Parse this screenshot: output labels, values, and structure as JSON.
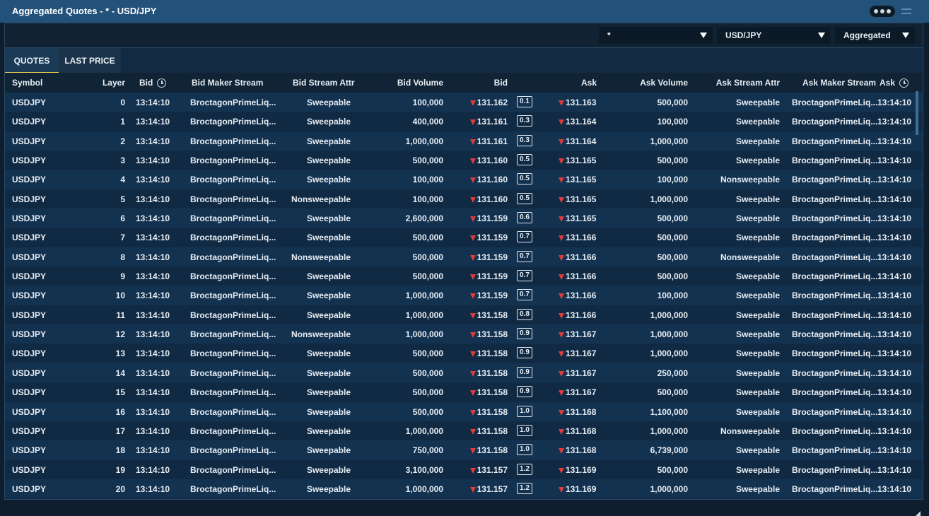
{
  "window": {
    "title": "Aggregated Quotes - * - USD/JPY",
    "more_icon": "ellipsis-icon",
    "menu_icon": "hamburger-icon"
  },
  "filters": {
    "stream": "*",
    "symbol": "USD/JPY",
    "mode": "Aggregated"
  },
  "tabs": [
    {
      "label": "QUOTES",
      "active": true
    },
    {
      "label": "LAST PRICE",
      "active": false
    }
  ],
  "columns": {
    "symbol": "Symbol",
    "layer": "Layer",
    "bid_time": "Bid",
    "bid_maker_stream": "Bid Maker Stream",
    "bid_stream_attr": "Bid Stream Attr",
    "bid_volume": "Bid Volume",
    "bid": "Bid",
    "ask": "Ask",
    "ask_volume": "Ask Volume",
    "ask_stream_attr": "Ask Stream Attr",
    "ask_maker_stream": "Ask Maker Stream",
    "ask_time": "Ask"
  },
  "colors": {
    "titlebar": "#22527a",
    "down_arrow": "#e03a3a",
    "active_tab_underline": "#e6c84e"
  },
  "rows": [
    [
      "USDJPY",
      "0",
      "13:14:10",
      "BroctagonPrimeLiq...",
      "Sweepable",
      "100,000",
      "131.162",
      "0.1",
      "131.163",
      "500,000",
      "Sweepable",
      "BroctagonPrimeLiq...",
      "13:14:10"
    ],
    [
      "USDJPY",
      "1",
      "13:14:10",
      "BroctagonPrimeLiq...",
      "Sweepable",
      "400,000",
      "131.161",
      "0.3",
      "131.164",
      "100,000",
      "Sweepable",
      "BroctagonPrimeLiq...",
      "13:14:10"
    ],
    [
      "USDJPY",
      "2",
      "13:14:10",
      "BroctagonPrimeLiq...",
      "Sweepable",
      "1,000,000",
      "131.161",
      "0.3",
      "131.164",
      "1,000,000",
      "Sweepable",
      "BroctagonPrimeLiq...",
      "13:14:10"
    ],
    [
      "USDJPY",
      "3",
      "13:14:10",
      "BroctagonPrimeLiq...",
      "Sweepable",
      "500,000",
      "131.160",
      "0.5",
      "131.165",
      "500,000",
      "Sweepable",
      "BroctagonPrimeLiq...",
      "13:14:10"
    ],
    [
      "USDJPY",
      "4",
      "13:14:10",
      "BroctagonPrimeLiq...",
      "Sweepable",
      "100,000",
      "131.160",
      "0.5",
      "131.165",
      "100,000",
      "Nonsweepable",
      "BroctagonPrimeLiq...",
      "13:14:10"
    ],
    [
      "USDJPY",
      "5",
      "13:14:10",
      "BroctagonPrimeLiq...",
      "Nonsweepable",
      "100,000",
      "131.160",
      "0.5",
      "131.165",
      "1,000,000",
      "Sweepable",
      "BroctagonPrimeLiq...",
      "13:14:10"
    ],
    [
      "USDJPY",
      "6",
      "13:14:10",
      "BroctagonPrimeLiq...",
      "Sweepable",
      "2,600,000",
      "131.159",
      "0.6",
      "131.165",
      "500,000",
      "Sweepable",
      "BroctagonPrimeLiq...",
      "13:14:10"
    ],
    [
      "USDJPY",
      "7",
      "13:14:10",
      "BroctagonPrimeLiq...",
      "Sweepable",
      "500,000",
      "131.159",
      "0.7",
      "131.166",
      "500,000",
      "Sweepable",
      "BroctagonPrimeLiq...",
      "13:14:10"
    ],
    [
      "USDJPY",
      "8",
      "13:14:10",
      "BroctagonPrimeLiq...",
      "Nonsweepable",
      "500,000",
      "131.159",
      "0.7",
      "131.166",
      "500,000",
      "Nonsweepable",
      "BroctagonPrimeLiq...",
      "13:14:10"
    ],
    [
      "USDJPY",
      "9",
      "13:14:10",
      "BroctagonPrimeLiq...",
      "Sweepable",
      "500,000",
      "131.159",
      "0.7",
      "131.166",
      "500,000",
      "Sweepable",
      "BroctagonPrimeLiq...",
      "13:14:10"
    ],
    [
      "USDJPY",
      "10",
      "13:14:10",
      "BroctagonPrimeLiq...",
      "Sweepable",
      "1,000,000",
      "131.159",
      "0.7",
      "131.166",
      "100,000",
      "Sweepable",
      "BroctagonPrimeLiq...",
      "13:14:10"
    ],
    [
      "USDJPY",
      "11",
      "13:14:10",
      "BroctagonPrimeLiq...",
      "Sweepable",
      "1,000,000",
      "131.158",
      "0.8",
      "131.166",
      "1,000,000",
      "Sweepable",
      "BroctagonPrimeLiq...",
      "13:14:10"
    ],
    [
      "USDJPY",
      "12",
      "13:14:10",
      "BroctagonPrimeLiq...",
      "Nonsweepable",
      "1,000,000",
      "131.158",
      "0.9",
      "131.167",
      "1,000,000",
      "Sweepable",
      "BroctagonPrimeLiq...",
      "13:14:10"
    ],
    [
      "USDJPY",
      "13",
      "13:14:10",
      "BroctagonPrimeLiq...",
      "Sweepable",
      "500,000",
      "131.158",
      "0.9",
      "131.167",
      "1,000,000",
      "Sweepable",
      "BroctagonPrimeLiq...",
      "13:14:10"
    ],
    [
      "USDJPY",
      "14",
      "13:14:10",
      "BroctagonPrimeLiq...",
      "Sweepable",
      "500,000",
      "131.158",
      "0.9",
      "131.167",
      "250,000",
      "Sweepable",
      "BroctagonPrimeLiq...",
      "13:14:10"
    ],
    [
      "USDJPY",
      "15",
      "13:14:10",
      "BroctagonPrimeLiq...",
      "Sweepable",
      "500,000",
      "131.158",
      "0.9",
      "131.167",
      "500,000",
      "Sweepable",
      "BroctagonPrimeLiq...",
      "13:14:10"
    ],
    [
      "USDJPY",
      "16",
      "13:14:10",
      "BroctagonPrimeLiq...",
      "Sweepable",
      "500,000",
      "131.158",
      "1.0",
      "131.168",
      "1,100,000",
      "Sweepable",
      "BroctagonPrimeLiq...",
      "13:14:10"
    ],
    [
      "USDJPY",
      "17",
      "13:14:10",
      "BroctagonPrimeLiq...",
      "Sweepable",
      "1,000,000",
      "131.158",
      "1.0",
      "131.168",
      "1,000,000",
      "Nonsweepable",
      "BroctagonPrimeLiq...",
      "13:14:10"
    ],
    [
      "USDJPY",
      "18",
      "13:14:10",
      "BroctagonPrimeLiq...",
      "Sweepable",
      "750,000",
      "131.158",
      "1.0",
      "131.168",
      "6,739,000",
      "Sweepable",
      "BroctagonPrimeLiq...",
      "13:14:10"
    ],
    [
      "USDJPY",
      "19",
      "13:14:10",
      "BroctagonPrimeLiq...",
      "Sweepable",
      "3,100,000",
      "131.157",
      "1.2",
      "131.169",
      "500,000",
      "Sweepable",
      "BroctagonPrimeLiq...",
      "13:14:10"
    ],
    [
      "USDJPY",
      "20",
      "13:14:10",
      "BroctagonPrimeLiq...",
      "Sweepable",
      "1,000,000",
      "131.157",
      "1.2",
      "131.169",
      "1,000,000",
      "Sweepable",
      "BroctagonPrimeLiq...",
      "13:14:10"
    ]
  ]
}
